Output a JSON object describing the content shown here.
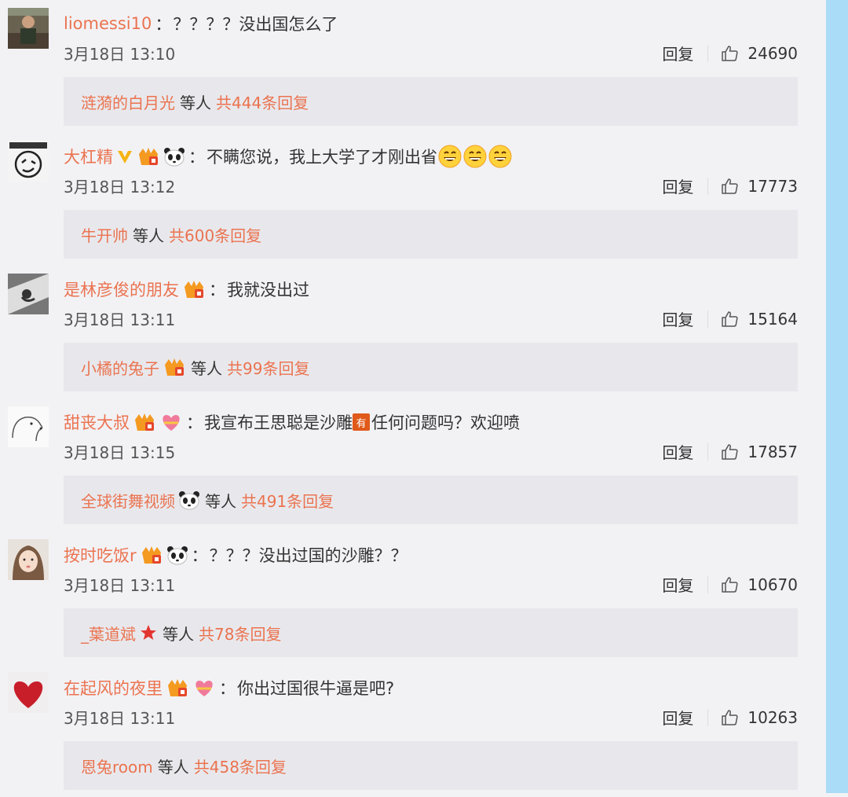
{
  "comments": [
    {
      "username": "liomessi10",
      "badges": [],
      "text": "？？？？没出国怎么了",
      "time": "3月18日 13:10",
      "reply_label": "回复",
      "likes": "24690",
      "sub": {
        "name": "涟漪的白月光",
        "name_badges": [],
        "mid": "等人",
        "count": "共444条回复"
      }
    },
    {
      "username": "大杠精",
      "badges": [
        "gold-v-icon",
        "crown-badge-icon",
        "panda-icon"
      ],
      "text": "不瞒您说，我上大学了才刚出省",
      "text_emoji": [
        "grin-emoji-icon",
        "grin-emoji-icon",
        "grin-emoji-icon"
      ],
      "time": "3月18日 13:12",
      "reply_label": "回复",
      "likes": "17773",
      "sub": {
        "name": "牛开帅",
        "name_badges": [],
        "mid": "等人",
        "count": "共600条回复"
      }
    },
    {
      "username": "是林彦俊的朋友",
      "badges": [
        "crown-badge-icon"
      ],
      "text": "我就没出过",
      "time": "3月18日 13:11",
      "reply_label": "回复",
      "likes": "15164",
      "sub": {
        "name": "小橘的兔子",
        "name_badges": [
          "crown-badge-icon"
        ],
        "mid": "等人",
        "count": "共99条回复"
      }
    },
    {
      "username": "甜丧大叔",
      "badges": [
        "crown-badge-icon",
        "heart-badge-icon"
      ],
      "text_before": "我宣布王思聪是沙雕",
      "text_after": "任何问题吗？欢迎喷",
      "time": "3月18日 13:15",
      "reply_label": "回复",
      "likes": "17857",
      "sub": {
        "name": "全球街舞视频",
        "name_badges": [
          "panda-icon"
        ],
        "mid": "等人",
        "count": "共491条回复"
      }
    },
    {
      "username": "按时吃饭r",
      "badges": [
        "crown-badge-icon",
        "panda-icon"
      ],
      "text": "？？？没出过国的沙雕？？",
      "time": "3月18日 13:11",
      "reply_label": "回复",
      "likes": "10670",
      "sub": {
        "name": "_葉道斌",
        "name_badges": [
          "red-star-icon"
        ],
        "mid": "等人",
        "count": "共78条回复"
      }
    },
    {
      "username": "在起风的夜里",
      "badges": [
        "crown-badge-icon",
        "heart-badge-icon"
      ],
      "text": "你出过国很牛逼是吧?",
      "time": "3月18日 13:11",
      "reply_label": "回复",
      "likes": "10263",
      "sub": {
        "name": "恩兔room",
        "name_badges": [],
        "mid": "等人",
        "count": "共458条回复"
      }
    }
  ],
  "inline_emoji_you": "有",
  "colors": {
    "accent": "#eb7350",
    "sidebar": "#aadcf8",
    "background": "#f2f2f5",
    "subbox": "#e8e8ec"
  }
}
